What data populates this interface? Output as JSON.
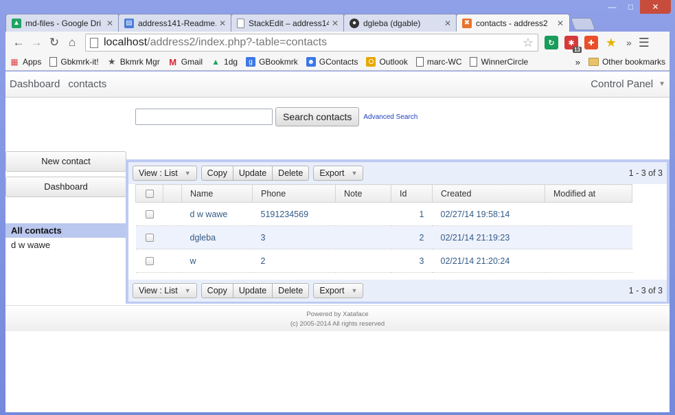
{
  "browser": {
    "tabs": [
      {
        "label": "md-files - Google Dri",
        "icon": "google-drive-icon",
        "color": "#1fa463"
      },
      {
        "label": "address141-Readme.",
        "icon": "document-icon",
        "color": "#4a7bd9"
      },
      {
        "label": "StackEdit – address14",
        "icon": "page-icon",
        "color": "#888888"
      },
      {
        "label": "dgleba (dgable)",
        "icon": "github-icon",
        "color": "#333333"
      },
      {
        "label": "contacts - address2",
        "icon": "xataface-icon",
        "color": "#e8742b",
        "active": true
      }
    ],
    "url_host": "localhost",
    "url_path": "/address2/index.php?-table=contacts",
    "bookmarks": [
      {
        "label": "Apps",
        "icon": "apps-icon"
      },
      {
        "label": "Gbkmrk-it!",
        "icon": "page-icon"
      },
      {
        "label": "Bkmrk Mgr",
        "icon": "star-icon"
      },
      {
        "label": "Gmail",
        "icon": "gmail-icon"
      },
      {
        "label": "1dg",
        "icon": "google-drive-icon"
      },
      {
        "label": "GBookmrk",
        "icon": "google-icon"
      },
      {
        "label": "GContacts",
        "icon": "contacts-icon"
      },
      {
        "label": "Outlook",
        "icon": "outlook-icon"
      },
      {
        "label": "marc-WC",
        "icon": "page-icon"
      },
      {
        "label": "WinnerCircle",
        "icon": "page-icon"
      }
    ],
    "bookmarks_more": "»",
    "other_bookmarks": "Other bookmarks",
    "extension_badge": "13"
  },
  "app": {
    "nav": {
      "dashboard": "Dashboard",
      "contacts": "contacts",
      "control_panel": "Control Panel"
    },
    "search": {
      "value": "",
      "button": "Search contacts",
      "advanced": "Advanced Search"
    },
    "sidebar": {
      "new_contact": "New contact",
      "dashboard": "Dashboard",
      "section_title": "All contacts",
      "items": [
        "d w wawe"
      ]
    },
    "resultbar": {
      "view": "View : List",
      "copy": "Copy",
      "update": "Update",
      "delete": "Delete",
      "export": "Export",
      "count": "1 - 3 of 3"
    },
    "table": {
      "columns": [
        "Name",
        "Phone",
        "Note",
        "Id",
        "Created",
        "Modified at"
      ],
      "rows": [
        {
          "name": "d w wawe",
          "phone": "5191234569",
          "note": "",
          "id": "1",
          "created": "02/27/14 19:58:14",
          "modified": ""
        },
        {
          "name": "dgleba",
          "phone": "3",
          "note": "",
          "id": "2",
          "created": "02/21/14 21:19:23",
          "modified": ""
        },
        {
          "name": "w",
          "phone": "2",
          "note": "",
          "id": "3",
          "created": "02/21/14 21:20:24",
          "modified": ""
        }
      ]
    },
    "footer": {
      "line1": "Powered by Xataface",
      "line2": "(c) 2005-2014 All rights reserved"
    }
  }
}
